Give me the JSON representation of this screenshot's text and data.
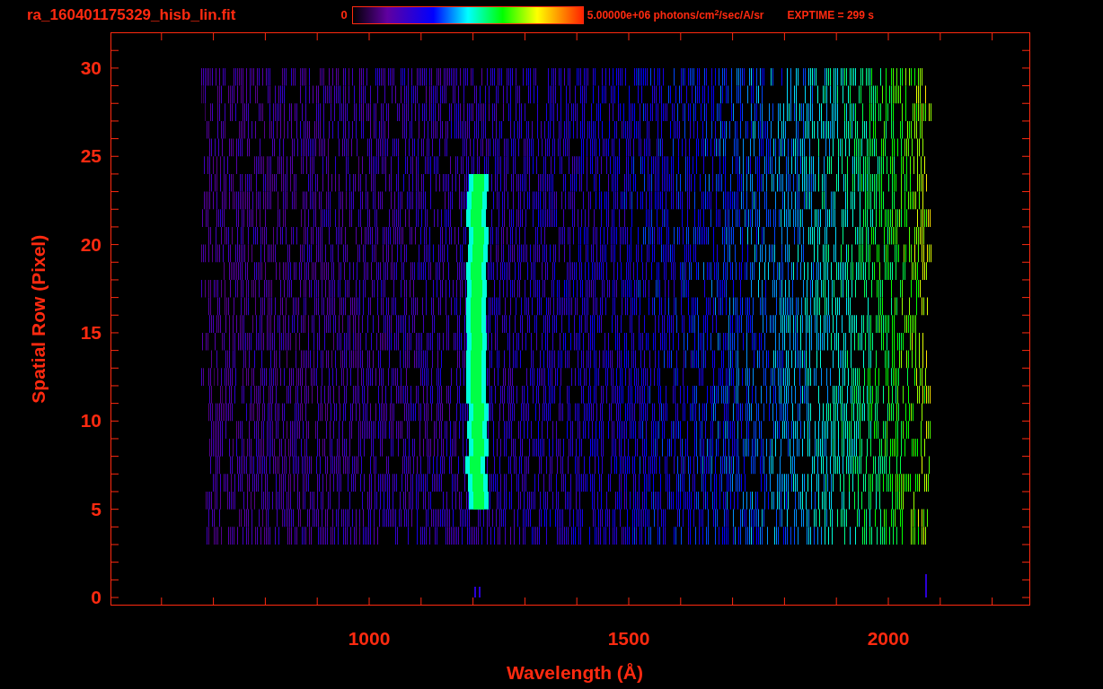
{
  "title": "ra_160401175329_hisb_lin.fit",
  "colorbar": {
    "min_label": "0",
    "max_label": "5.00000e+06 photons/cm$^{2}$/sec/A/sr"
  },
  "exposure": "EXPTIME = 299 s",
  "y_axis": {
    "label": "Spatial Row (Pixel)",
    "ticks": [
      "30",
      "25",
      "20",
      "15",
      "10",
      "5",
      "0"
    ]
  },
  "x_axis": {
    "label": "Wavelength (Å)",
    "ticks": [
      "1000",
      "1500",
      "2000"
    ]
  }
}
